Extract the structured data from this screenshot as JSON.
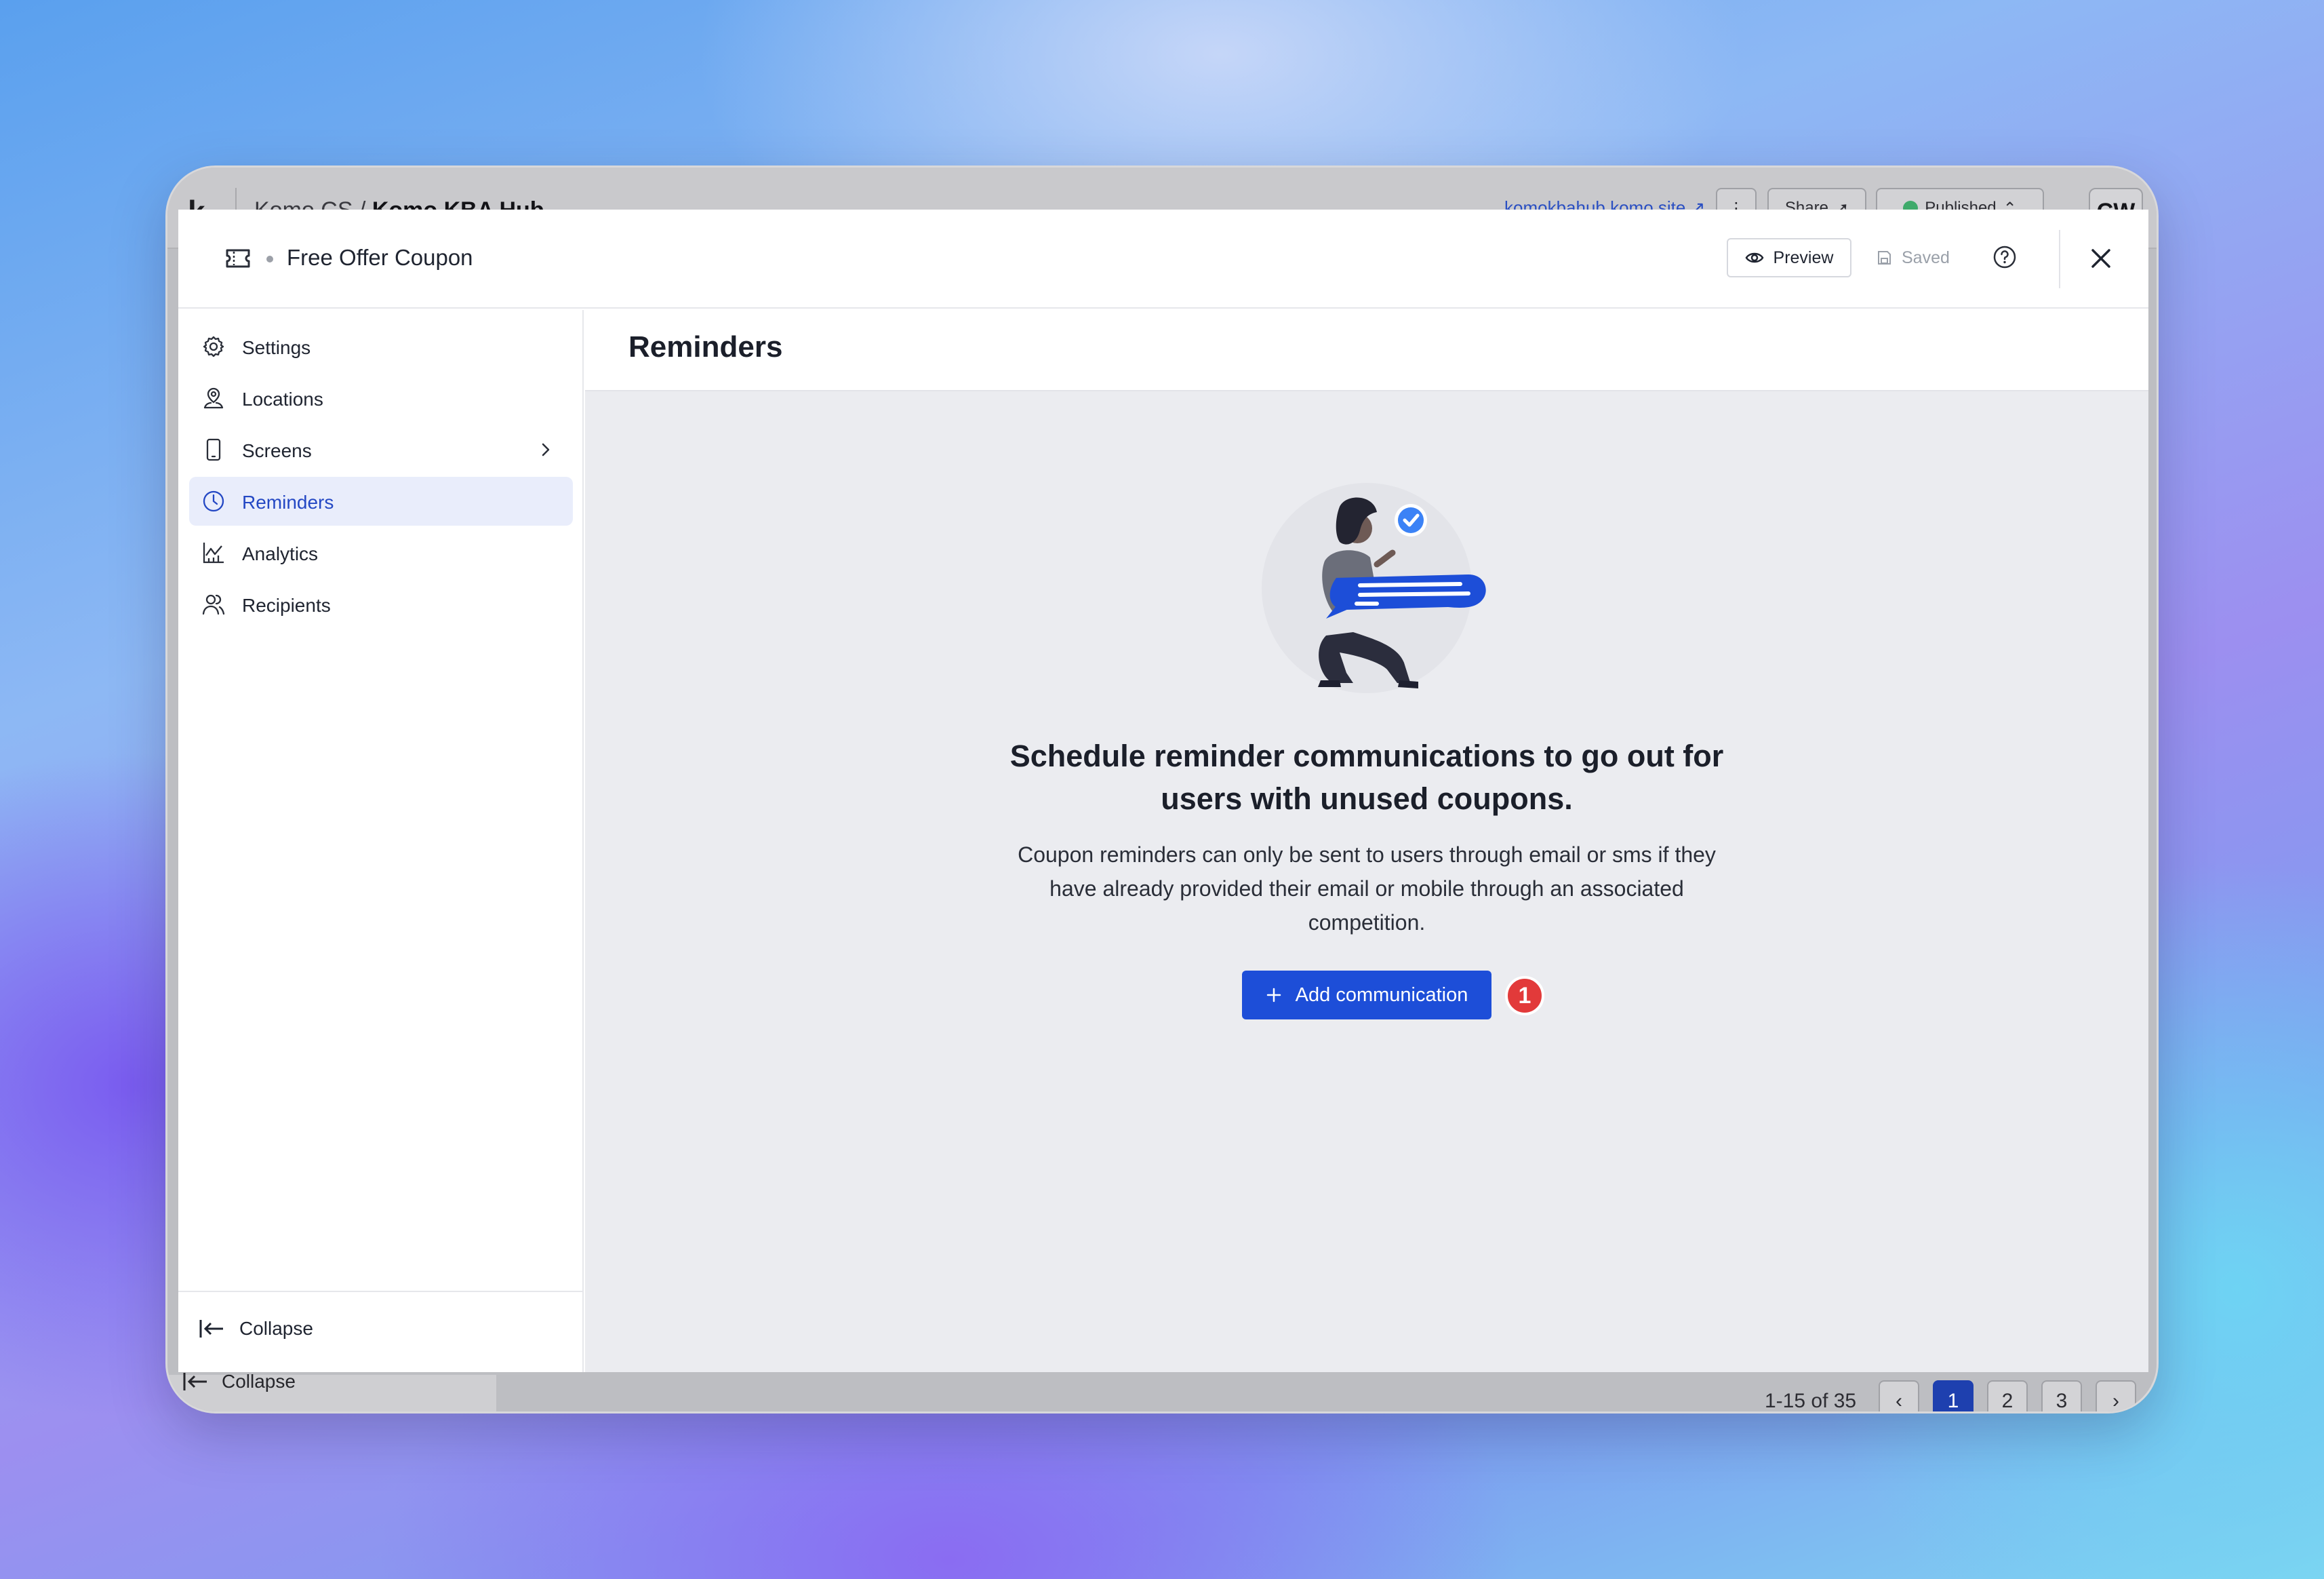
{
  "background_app": {
    "logo": "k",
    "breadcrumb_parent": "Komo CS",
    "breadcrumb_sep": "/",
    "breadcrumb_current": "Komo KBA Hub",
    "site_link": "komokbahub.komo.site",
    "share_label": "Share",
    "status_label": "Published",
    "avatar_initials": "CW",
    "collapse_label": "Collapse",
    "pager": {
      "range_text": "1-15 of 35",
      "pages": [
        "1",
        "2",
        "3"
      ],
      "active_page": "1"
    }
  },
  "modal": {
    "title": "Free Offer Coupon",
    "preview_label": "Preview",
    "saved_label": "Saved"
  },
  "sidebar": {
    "items": [
      {
        "label": "Settings",
        "icon": "gear-icon"
      },
      {
        "label": "Locations",
        "icon": "location-person-icon"
      },
      {
        "label": "Screens",
        "icon": "phone-icon"
      },
      {
        "label": "Reminders",
        "icon": "clock-icon",
        "active": true
      },
      {
        "label": "Analytics",
        "icon": "chart-icon"
      },
      {
        "label": "Recipients",
        "icon": "users-icon"
      }
    ],
    "collapse_label": "Collapse"
  },
  "content": {
    "title": "Reminders",
    "empty_title": "Schedule reminder communications to go out for users with unused coupons.",
    "empty_desc": "Coupon reminders can only be sent to users through email or sms if they have already provided their email or mobile through an associated competition.",
    "add_button_label": "Add communication",
    "step_badge": "1"
  },
  "colors": {
    "accent": "#1d4ed8",
    "active_nav_bg": "#e9edfb",
    "badge": "#e23a3a"
  }
}
